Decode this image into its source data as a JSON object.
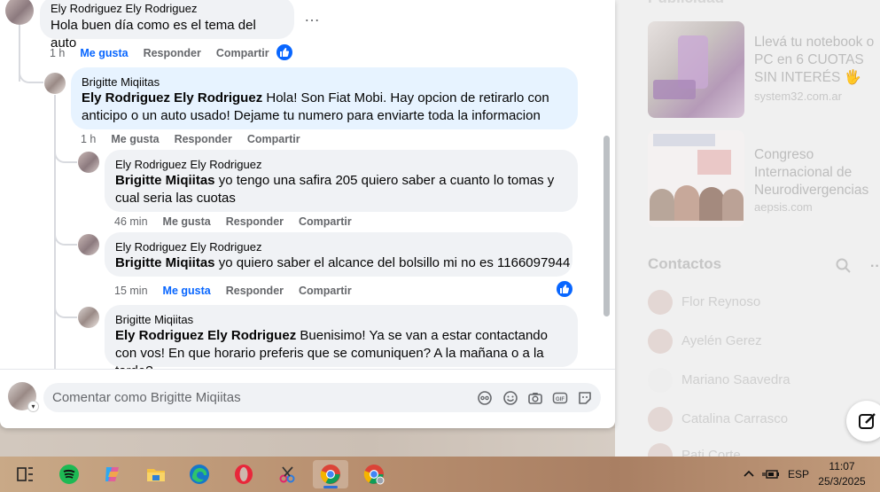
{
  "right_pane": {
    "publicidad_label": "Publicidad",
    "ads": [
      {
        "title": "Llevá tu notebook o PC en 6 CUOTAS SIN INTERÉS 🖐",
        "url": "system32.com.ar"
      },
      {
        "title": "Congreso Internacional de Neurodivergencias",
        "url": "aepsis.com"
      }
    ],
    "contacts_label": "Contactos",
    "contacts": [
      "Flor Reynoso",
      "Ayelén Gerez",
      "Mariano Saavedra",
      "Catalina Carrasco",
      "Pati Corte"
    ]
  },
  "thread": {
    "comments": [
      {
        "author": "Ely Rodriguez Ely Rodriguez",
        "mention": "",
        "text": "Hola buen día como es el tema del auto",
        "time": "1 h",
        "like": "Me gusta",
        "reply": "Responder",
        "share": "Compartir",
        "liked": true
      },
      {
        "author": "Brigitte Miqiitas",
        "mention": "Ely Rodriguez Ely Rodriguez",
        "text": "Hola! Son Fiat Mobi. Hay opcion de retirarlo con anticipo o un auto usado! Dejame tu numero para enviarte toda la informacion",
        "time": "1 h",
        "like": "Me gusta",
        "reply": "Responder",
        "share": "Compartir"
      },
      {
        "author": "Ely Rodriguez Ely Rodriguez",
        "mention": "Brigitte Miqiitas",
        "text": "yo tengo una safira 205 quiero saber a cuanto lo tomas y cual seria las cuotas",
        "time": "46 min",
        "like": "Me gusta",
        "reply": "Responder",
        "share": "Compartir"
      },
      {
        "author": "Ely Rodriguez Ely Rodriguez",
        "mention": "Brigitte Miqiitas",
        "text": "yo quiero saber el alcance del bolsillo mi no es 1166097944",
        "time": "15 min",
        "like": "Me gusta",
        "reply": "Responder",
        "share": "Compartir",
        "liked": true
      },
      {
        "author": "Brigitte Miqiitas",
        "mention": "Ely Rodriguez Ely Rodriguez",
        "text": "Buenisimo! Ya se van a estar contactando con vos! En que horario preferis que se comuniquen? A la mañana o a la tarde?",
        "time": "",
        "like": "",
        "reply": "",
        "share": ""
      }
    ],
    "more_glyph": "…"
  },
  "composer": {
    "placeholder": "Comentar como Brigitte Miqiitas"
  },
  "taskbar": {
    "apps": [
      "task-view",
      "spotify",
      "copilot",
      "file-explorer",
      "edge",
      "opera",
      "snipping-tool",
      "chrome",
      "chrome-profile"
    ],
    "language": "ESP",
    "time": "11:07",
    "date": "25/3/2025"
  }
}
